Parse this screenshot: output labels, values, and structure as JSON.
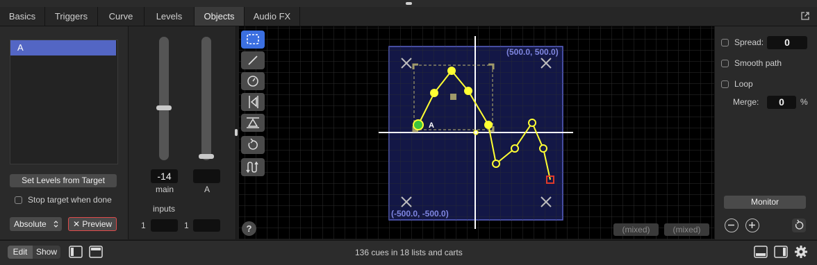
{
  "tabs": [
    "Basics",
    "Triggers",
    "Curve",
    "Levels",
    "Objects",
    "Audio FX"
  ],
  "active_tab": "Objects",
  "left": {
    "targets": [
      "A"
    ],
    "set_levels_label": "Set Levels from Target",
    "stop_target_label": "Stop target when done",
    "mode_value": "Absolute",
    "preview_label": "Preview"
  },
  "sliders": {
    "main_value": "-14",
    "main_label": "main",
    "a_value": "",
    "a_label": "A",
    "inputs_label": "inputs",
    "input1_index": "1",
    "input2_index": "1"
  },
  "canvas": {
    "top_right_coord": "(500.0, 500.0)",
    "bottom_left_coord": "(-500.0, -500.0)",
    "object_label": "A",
    "mixed_1": "(mixed)",
    "mixed_2": "(mixed)",
    "help": "?"
  },
  "right": {
    "spread_label": "Spread:",
    "spread_value": "0",
    "smooth_label": "Smooth path",
    "loop_label": "Loop",
    "merge_label": "Merge:",
    "merge_value": "0",
    "merge_unit": "%",
    "monitor_label": "Monitor"
  },
  "bottom": {
    "edit_label": "Edit",
    "show_label": "Show",
    "status": "136 cues in 18 lists and carts"
  },
  "icons": [
    "pop-out-icon",
    "marquee-select-icon",
    "line-tool-icon",
    "gauge-icon",
    "flip-horizontal-icon",
    "flip-vertical-icon",
    "rotate-icon",
    "path-icon",
    "zoom-out-icon",
    "zoom-in-icon",
    "reset-icon",
    "left-panel-icon",
    "top-panel-icon",
    "bottom-panel-icon",
    "right-panel-icon",
    "gear-icon"
  ],
  "colors": {
    "accent": "#5366c4",
    "path": "#ffff33",
    "stage": "#14184a",
    "selection": "#a09a6a",
    "preview_border": "#e04a4a"
  }
}
